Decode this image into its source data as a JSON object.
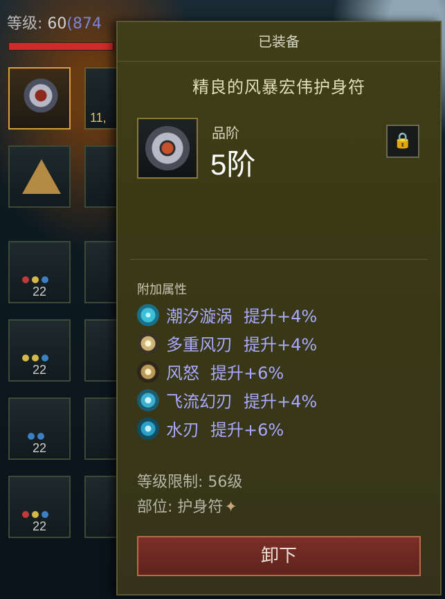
{
  "top_level": {
    "label": "等级:",
    "level": "60",
    "paren": "(874"
  },
  "slots": [
    {
      "level": "11,"
    },
    {
      "level": "22"
    },
    {
      "level": "22"
    },
    {
      "level": "22"
    },
    {
      "level": "22"
    }
  ],
  "panel": {
    "header": "已装备",
    "item_name": "精良的风暴宏伟护身符",
    "grade_label": "品阶",
    "grade_value": "5阶",
    "attr_title": "附加属性",
    "attributes": [
      {
        "name": "潮汐漩涡",
        "effect": "提升+4%",
        "icon": "tide-vortex-icon",
        "color": "#3cc0d8"
      },
      {
        "name": "多重风刃",
        "effect": "提升+4%",
        "icon": "multi-wind-blade-icon",
        "color": "#e6d6a0"
      },
      {
        "name": "风怒",
        "effect": "提升+6%",
        "icon": "wind-fury-icon",
        "color": "#d9c48d"
      },
      {
        "name": "飞流幻刃",
        "effect": "提升+4%",
        "icon": "flowing-blade-icon",
        "color": "#3cb0d0"
      },
      {
        "name": "水刃",
        "effect": "提升+6%",
        "icon": "water-blade-icon",
        "color": "#2aa0c6"
      }
    ],
    "level_req": "等级限制: 56级",
    "slot_label": "部位: 护身符",
    "unequip_label": "卸下"
  },
  "colors": {
    "panel_bg": "#3f3e16",
    "attr_text": "#aaa9ff",
    "button_bg": "#7b2e27"
  }
}
